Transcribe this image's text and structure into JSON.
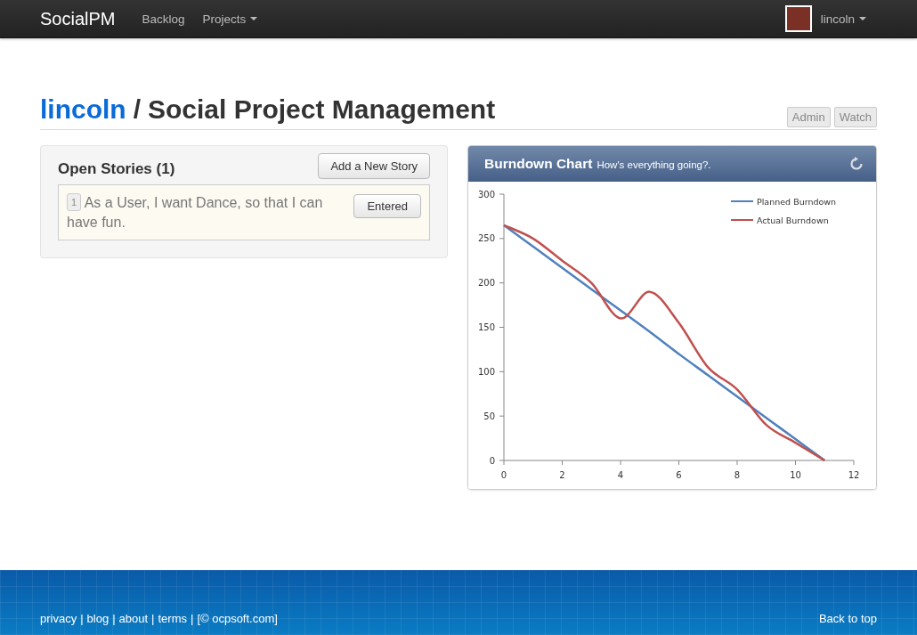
{
  "navbar": {
    "brand": "SocialPM",
    "items": [
      {
        "label": "Backlog",
        "dropdown": false
      },
      {
        "label": "Projects",
        "dropdown": true
      }
    ],
    "user": {
      "name": "lincoln",
      "dropdown": true
    }
  },
  "page_header": {
    "owner": "lincoln",
    "separator": "/",
    "project": "Social Project Management",
    "actions": [
      {
        "label": "Admin"
      },
      {
        "label": "Watch"
      }
    ]
  },
  "open_stories": {
    "title": "Open Stories (1)",
    "add_button": "Add a New Story",
    "stories": [
      {
        "number": "1",
        "text": "As a User, I want Dance, so that I can have fun.",
        "status": "Entered"
      }
    ]
  },
  "burndown": {
    "title": "Burndown Chart",
    "subtitle": "How's everything going?.",
    "chart_data": {
      "type": "line",
      "x": [
        0,
        1,
        2,
        3,
        4,
        5,
        6,
        7,
        8,
        9,
        10,
        11
      ],
      "legend": true,
      "xlim": [
        0,
        12
      ],
      "ylim": [
        0,
        300
      ],
      "xticks": [
        0,
        2,
        4,
        6,
        8,
        10,
        12
      ],
      "yticks": [
        0,
        50,
        100,
        150,
        200,
        250,
        300
      ],
      "series": [
        {
          "name": "Planned Burndown",
          "color": "#4f81bd",
          "values": [
            265,
            241,
            217,
            193,
            169,
            145,
            120,
            96,
            72,
            48,
            24,
            0
          ]
        },
        {
          "name": "Actual Burndown",
          "color": "#c0504d",
          "values": [
            265,
            250,
            225,
            200,
            160,
            190,
            155,
            105,
            80,
            40,
            20,
            0
          ]
        }
      ]
    }
  },
  "footer": {
    "links": [
      {
        "label": "privacy"
      },
      {
        "label": "blog"
      },
      {
        "label": "about"
      },
      {
        "label": "terms"
      },
      {
        "label": "[© ocpsoft.com]"
      }
    ],
    "separator": "|",
    "back_to_top": "Back to top"
  }
}
